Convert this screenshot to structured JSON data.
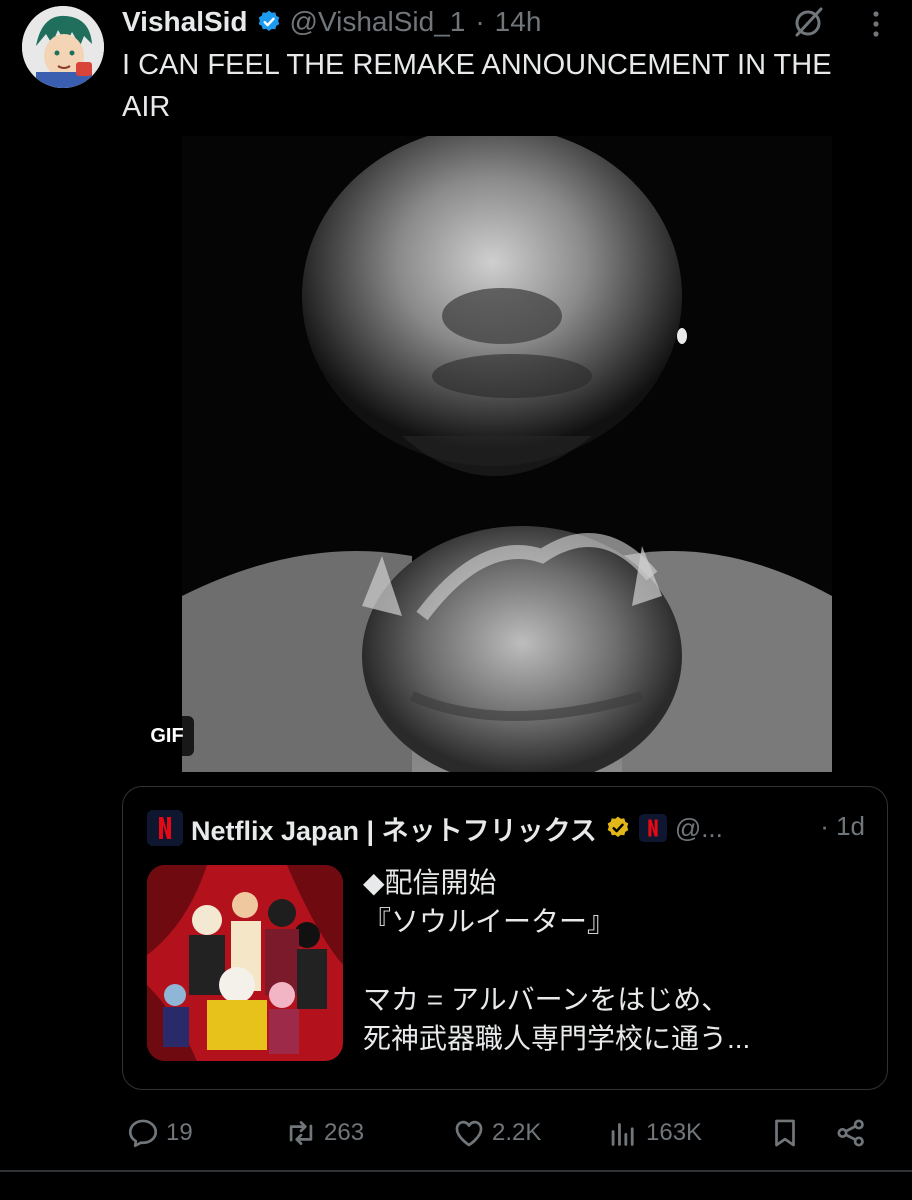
{
  "author": {
    "display_name": "VishalSid",
    "handle": "@VishalSid_1",
    "separator": "·",
    "time": "14h",
    "verified": true
  },
  "tweet": {
    "text": "I CAN FEEL THE REMAKE ANNOUNCEMENT IN THE AIR"
  },
  "media": {
    "badge": "GIF"
  },
  "quote": {
    "display_name": "Netflix Japan | ネットフリックス",
    "handle": "@...",
    "time": "· 1d",
    "text": "◆配信開始\n『ソウルイーター』\n\nマカ = アルバーンをはじめ、\n死神武器職人専門学校に通う..."
  },
  "actions": {
    "replies": "19",
    "retweets": "263",
    "likes": "2.2K",
    "views": "163K"
  },
  "colors": {
    "background": "#000000",
    "text": "#e7e9ea",
    "muted": "#71767b",
    "verified_blue": "#1d9bf0",
    "verified_gold": "#e2b719",
    "netflix_red": "#e50914",
    "border": "#2f3336"
  },
  "icons": {
    "verified": "verified-badge-icon",
    "grok": "grok-icon",
    "more": "more-icon",
    "reply": "reply-icon",
    "retweet": "retweet-icon",
    "like": "heart-icon",
    "views": "views-icon",
    "bookmark": "bookmark-icon",
    "share": "share-icon"
  }
}
